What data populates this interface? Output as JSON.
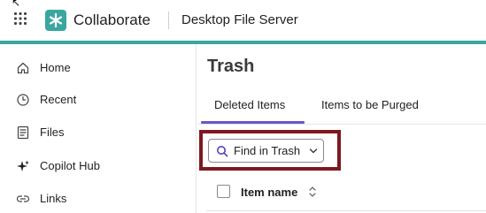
{
  "colors": {
    "accent": "#3aa6a0",
    "highlight": "#7b1a1f",
    "tab_indicator": "#6b56c7"
  },
  "header": {
    "brand": "Collaborate",
    "server": "Desktop File Server",
    "icons": [
      "app-grid-icon",
      "collaborate-logo"
    ]
  },
  "sidebar": {
    "items": [
      {
        "label": "Home",
        "icon": "home-icon"
      },
      {
        "label": "Recent",
        "icon": "clock-icon"
      },
      {
        "label": "Files",
        "icon": "files-icon"
      },
      {
        "label": "Copilot Hub",
        "icon": "sparkle-icon"
      },
      {
        "label": "Links",
        "icon": "link-icon"
      }
    ]
  },
  "main": {
    "title": "Trash",
    "tabs": [
      {
        "label": "Deleted Items",
        "active": true
      },
      {
        "label": "Items to be Purged",
        "active": false
      }
    ],
    "find_button": {
      "label": "Find in Trash",
      "icon": "search-icon"
    },
    "table": {
      "columns": [
        {
          "label": "Item name",
          "sortable": true
        }
      ]
    }
  }
}
